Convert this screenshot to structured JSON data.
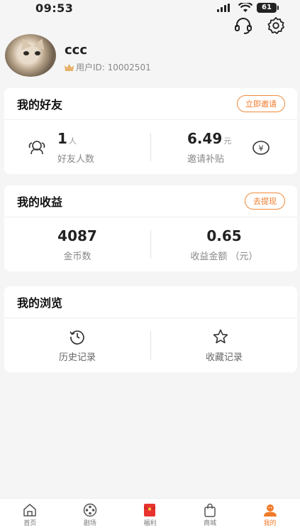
{
  "status": {
    "time": "09:53",
    "battery": "61"
  },
  "header": {
    "support_icon": "headset-icon",
    "settings_icon": "gear-icon"
  },
  "profile": {
    "username": "ccc",
    "user_id": "用户ID: 10002501"
  },
  "friends": {
    "title": "我的好友",
    "action": "立即邀请",
    "count": "1",
    "count_unit": "人",
    "count_label": "好友人数",
    "subsidy": "6.49",
    "subsidy_unit": "元",
    "subsidy_label": "邀请补贴"
  },
  "earnings": {
    "title": "我的收益",
    "action": "去提现",
    "coins": "4087",
    "coins_label": "金币数",
    "amount": "0.65",
    "amount_label": "收益金额 （元）"
  },
  "browse": {
    "title": "我的浏览",
    "history_label": "历史记录",
    "favorites_label": "收藏记录"
  },
  "nav": {
    "items": [
      {
        "label": "首页",
        "icon": "home-icon"
      },
      {
        "label": "剧场",
        "icon": "film-reel-icon"
      },
      {
        "label": "福利",
        "icon": "red-envelope-icon"
      },
      {
        "label": "商城",
        "icon": "shopping-bag-icon"
      },
      {
        "label": "我的",
        "icon": "profile-icon"
      }
    ],
    "accent": "#f07a28"
  }
}
